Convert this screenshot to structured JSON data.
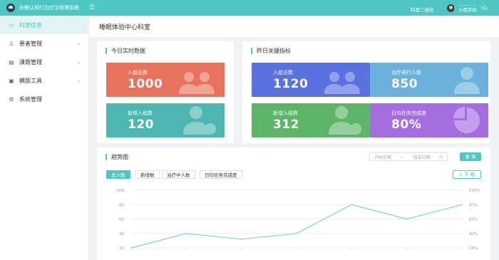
{
  "app": {
    "title": "失眠认知行为疗法管理系统",
    "user_name": "睡眠体验中心"
  },
  "sidebar": {
    "items": [
      {
        "label": "科室信息",
        "icon": "home-icon"
      },
      {
        "label": "患者管理",
        "icon": "user-icon"
      },
      {
        "label": "课题管理",
        "icon": "clipboard-icon"
      },
      {
        "label": "模版工具",
        "icon": "template-icon"
      },
      {
        "label": "系统管理",
        "icon": "settings-icon"
      }
    ]
  },
  "header": {
    "title": "睡眠体验中心科室",
    "qr_button": "科室二维码",
    "mini_button": "小程序码"
  },
  "today": {
    "title": "今日实时数据",
    "cards": [
      {
        "label": "入组总数",
        "value": "1000",
        "color": "#e8735d"
      },
      {
        "label": "新增入组数",
        "value": "120",
        "color": "#4db6b0"
      }
    ]
  },
  "yesterday": {
    "title": "昨日关键指标",
    "cards": [
      {
        "label": "入组总数",
        "value": "1120",
        "color": "#5a72e0"
      },
      {
        "label": "治疗进行人数",
        "value": "850",
        "color": "#6ab2dc"
      },
      {
        "label": "新增入组数",
        "value": "312",
        "color": "#5db668"
      },
      {
        "label": "日均任务完成度",
        "value": "80%",
        "color": "#a56ee0"
      }
    ]
  },
  "trend": {
    "title": "趋势图",
    "date_start": "开始日期",
    "date_sep": "—",
    "date_end": "结束日期",
    "query_button": "查 询",
    "download_button": "下 载",
    "tabs": [
      "总人数",
      "新增数",
      "治疗中人数",
      "日均任务完成度"
    ]
  },
  "chart_data": {
    "type": "line",
    "x": [
      1,
      2,
      3,
      4,
      5,
      6,
      7
    ],
    "series": [
      {
        "values": [
          20,
          40,
          32,
          40,
          80,
          60,
          80
        ]
      }
    ],
    "y_left_ticks": [
      "100",
      "80",
      "60",
      "40",
      "20"
    ],
    "y_right_ticks": [
      "100%",
      "80%",
      "60%",
      "40%",
      "20%"
    ],
    "ylim": [
      20,
      100
    ],
    "color": "#7ed0dc",
    "grid": true
  }
}
